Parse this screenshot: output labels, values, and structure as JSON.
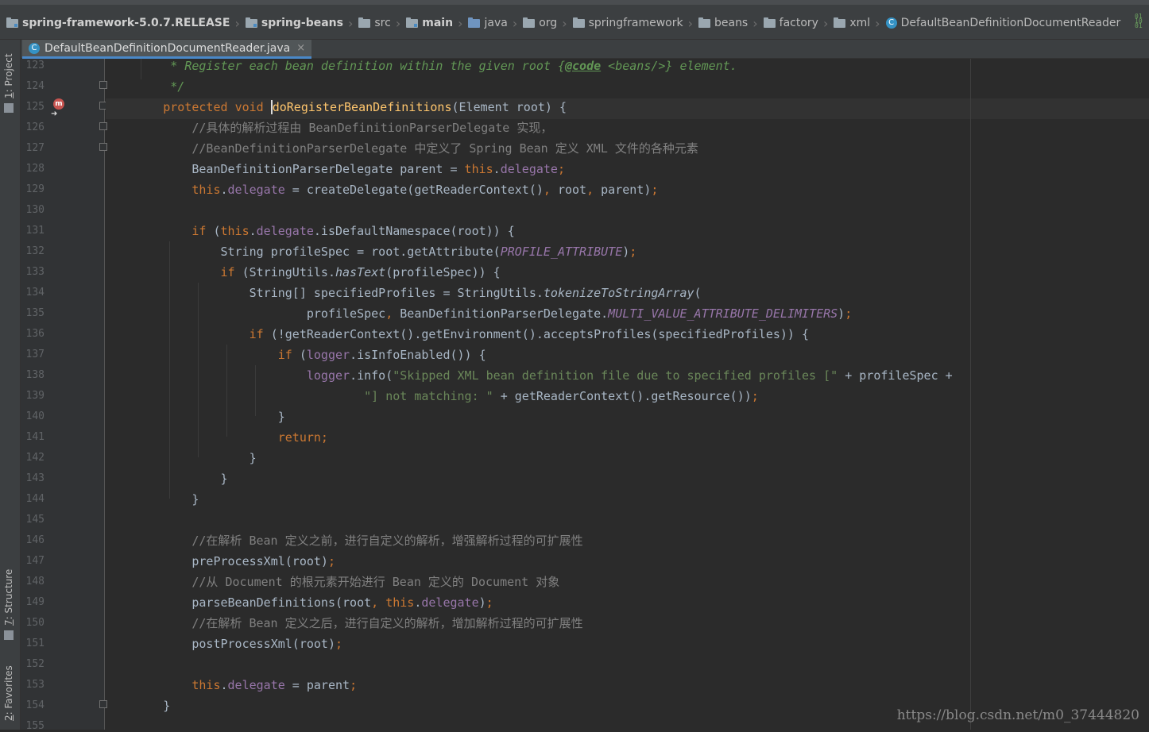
{
  "breadcrumbs": [
    {
      "label": "spring-framework-5.0.7.RELEASE",
      "icon": "module-folder-icon",
      "bold": true
    },
    {
      "label": "spring-beans",
      "icon": "module-folder-icon",
      "bold": true
    },
    {
      "label": "src",
      "icon": "folder-icon"
    },
    {
      "label": "main",
      "icon": "module-folder-icon",
      "bold": true
    },
    {
      "label": "java",
      "icon": "source-folder-icon"
    },
    {
      "label": "org",
      "icon": "package-icon"
    },
    {
      "label": "springframework",
      "icon": "package-icon"
    },
    {
      "label": "beans",
      "icon": "package-icon"
    },
    {
      "label": "factory",
      "icon": "package-icon"
    },
    {
      "label": "xml",
      "icon": "package-icon"
    },
    {
      "label": "DefaultBeanDefinitionDocumentReader",
      "icon": "class-icon"
    }
  ],
  "editor_tab": {
    "title": "DefaultBeanDefinitionDocumentReader.java",
    "close": "×",
    "icon_letter": "C"
  },
  "tool_windows": {
    "project": {
      "num": "1",
      "label": ": Project"
    },
    "structure": {
      "num": "7",
      "label": ": Structure"
    },
    "favorites": {
      "num": "2",
      "label": ": Favorites"
    }
  },
  "breakpoint_letter": "m",
  "line_numbers": [
    "123",
    "124",
    "125",
    "126",
    "127",
    "128",
    "129",
    "130",
    "131",
    "132",
    "133",
    "134",
    "135",
    "136",
    "137",
    "138",
    "139",
    "140",
    "141",
    "142",
    "143",
    "144",
    "145",
    "146",
    "147",
    "148",
    "149",
    "150",
    "151",
    "152",
    "153",
    "154",
    "155"
  ],
  "code_lines": [
    [
      {
        "t": "         ",
        "c": ""
      },
      {
        "t": "* Register each bean definition within the given root ",
        "c": "dcm"
      },
      {
        "t": "{",
        "c": "dcm"
      },
      {
        "t": "@code",
        "c": "dtag"
      },
      {
        "t": " <beans/>} element.",
        "c": "dcm"
      }
    ],
    [
      {
        "t": "         ",
        "c": ""
      },
      {
        "t": "*/",
        "c": "dcm"
      }
    ],
    [
      {
        "t": "        ",
        "c": ""
      },
      {
        "t": "protected",
        "c": "kw"
      },
      {
        "t": " ",
        "c": ""
      },
      {
        "t": "void",
        "c": "kw"
      },
      {
        "t": " ",
        "c": ""
      },
      {
        "t": "doRegisterBeanDefinitions",
        "c": "fn caret"
      },
      {
        "t": "(Element root) {",
        "c": ""
      }
    ],
    [
      {
        "t": "            ",
        "c": ""
      },
      {
        "t": "//具体的解析过程由 BeanDefinitionParserDelegate 实现，",
        "c": "cmt"
      }
    ],
    [
      {
        "t": "            ",
        "c": ""
      },
      {
        "t": "//BeanDefinitionParserDelegate 中定义了 Spring Bean 定义 XML 文件的各种元素",
        "c": "cmt"
      }
    ],
    [
      {
        "t": "            BeanDefinitionParserDelegate parent = ",
        "c": ""
      },
      {
        "t": "this",
        "c": "kw"
      },
      {
        "t": ".",
        "c": ""
      },
      {
        "t": "delegate",
        "c": "fld"
      },
      {
        "t": ";",
        "c": "kw"
      }
    ],
    [
      {
        "t": "            ",
        "c": ""
      },
      {
        "t": "this",
        "c": "kw"
      },
      {
        "t": ".",
        "c": ""
      },
      {
        "t": "delegate",
        "c": "fld"
      },
      {
        "t": " = createDelegate(getReaderContext()",
        "c": ""
      },
      {
        "t": ",",
        "c": "kw"
      },
      {
        "t": " root",
        "c": ""
      },
      {
        "t": ",",
        "c": "kw"
      },
      {
        "t": " parent)",
        "c": ""
      },
      {
        "t": ";",
        "c": "kw"
      }
    ],
    [
      {
        "t": "",
        "c": ""
      }
    ],
    [
      {
        "t": "            ",
        "c": ""
      },
      {
        "t": "if",
        "c": "kw"
      },
      {
        "t": " (",
        "c": ""
      },
      {
        "t": "this",
        "c": "kw"
      },
      {
        "t": ".",
        "c": ""
      },
      {
        "t": "delegate",
        "c": "fld"
      },
      {
        "t": ".isDefaultNamespace(root)) {",
        "c": ""
      }
    ],
    [
      {
        "t": "                String profileSpec = root.getAttribute(",
        "c": ""
      },
      {
        "t": "PROFILE_ATTRIBUTE",
        "c": "cst"
      },
      {
        "t": ")",
        "c": ""
      },
      {
        "t": ";",
        "c": "kw"
      }
    ],
    [
      {
        "t": "                ",
        "c": ""
      },
      {
        "t": "if",
        "c": "kw"
      },
      {
        "t": " (StringUtils.",
        "c": ""
      },
      {
        "t": "hasText",
        "c": "sta"
      },
      {
        "t": "(profileSpec)) {",
        "c": ""
      }
    ],
    [
      {
        "t": "                    String[] specifiedProfiles = StringUtils.",
        "c": ""
      },
      {
        "t": "tokenizeToStringArray",
        "c": "sta"
      },
      {
        "t": "(",
        "c": ""
      }
    ],
    [
      {
        "t": "                            profileSpec",
        "c": ""
      },
      {
        "t": ",",
        "c": "kw"
      },
      {
        "t": " BeanDefinitionParserDelegate.",
        "c": ""
      },
      {
        "t": "MULTI_VALUE_ATTRIBUTE_DELIMITERS",
        "c": "cst"
      },
      {
        "t": ")",
        "c": ""
      },
      {
        "t": ";",
        "c": "kw"
      }
    ],
    [
      {
        "t": "                    ",
        "c": ""
      },
      {
        "t": "if",
        "c": "kw"
      },
      {
        "t": " (!getReaderContext().getEnvironment().acceptsProfiles(specifiedProfiles)) {",
        "c": ""
      }
    ],
    [
      {
        "t": "                        ",
        "c": ""
      },
      {
        "t": "if",
        "c": "kw"
      },
      {
        "t": " (",
        "c": ""
      },
      {
        "t": "logger",
        "c": "fld"
      },
      {
        "t": ".isInfoEnabled()) {",
        "c": ""
      }
    ],
    [
      {
        "t": "                            ",
        "c": ""
      },
      {
        "t": "logger",
        "c": "fld"
      },
      {
        "t": ".info(",
        "c": ""
      },
      {
        "t": "\"Skipped XML bean definition file due to specified profiles [\"",
        "c": "str"
      },
      {
        "t": " + profileSpec +",
        "c": ""
      }
    ],
    [
      {
        "t": "                                    ",
        "c": ""
      },
      {
        "t": "\"] not matching: \"",
        "c": "str"
      },
      {
        "t": " + getReaderContext().getResource())",
        "c": ""
      },
      {
        "t": ";",
        "c": "kw"
      }
    ],
    [
      {
        "t": "                        }",
        "c": ""
      }
    ],
    [
      {
        "t": "                        ",
        "c": ""
      },
      {
        "t": "return;",
        "c": "kw"
      }
    ],
    [
      {
        "t": "                    }",
        "c": ""
      }
    ],
    [
      {
        "t": "                }",
        "c": ""
      }
    ],
    [
      {
        "t": "            }",
        "c": ""
      }
    ],
    [
      {
        "t": "",
        "c": ""
      }
    ],
    [
      {
        "t": "            ",
        "c": ""
      },
      {
        "t": "//在解析 Bean 定义之前，进行自定义的解析，增强解析过程的可扩展性",
        "c": "cmt"
      }
    ],
    [
      {
        "t": "            preProcessXml(root)",
        "c": ""
      },
      {
        "t": ";",
        "c": "kw"
      }
    ],
    [
      {
        "t": "            ",
        "c": ""
      },
      {
        "t": "//从 Document 的根元素开始进行 Bean 定义的 Document 对象",
        "c": "cmt"
      }
    ],
    [
      {
        "t": "            parseBeanDefinitions(root",
        "c": ""
      },
      {
        "t": ",",
        "c": "kw"
      },
      {
        "t": " ",
        "c": ""
      },
      {
        "t": "this",
        "c": "kw"
      },
      {
        "t": ".",
        "c": ""
      },
      {
        "t": "delegate",
        "c": "fld"
      },
      {
        "t": ")",
        "c": ""
      },
      {
        "t": ";",
        "c": "kw"
      }
    ],
    [
      {
        "t": "            ",
        "c": ""
      },
      {
        "t": "//在解析 Bean 定义之后，进行自定义的解析，增加解析过程的可扩展性",
        "c": "cmt"
      }
    ],
    [
      {
        "t": "            postProcessXml(root)",
        "c": ""
      },
      {
        "t": ";",
        "c": "kw"
      }
    ],
    [
      {
        "t": "",
        "c": ""
      }
    ],
    [
      {
        "t": "            ",
        "c": ""
      },
      {
        "t": "this",
        "c": "kw"
      },
      {
        "t": ".",
        "c": ""
      },
      {
        "t": "delegate",
        "c": "fld"
      },
      {
        "t": " = parent",
        "c": ""
      },
      {
        "t": ";",
        "c": "kw"
      }
    ],
    [
      {
        "t": "        }",
        "c": ""
      }
    ],
    [
      {
        "t": "",
        "c": ""
      }
    ]
  ],
  "current_line_index": 2,
  "watermark": "https://blog.csdn.net/m0_37444820",
  "colors": {
    "background": "#2b2b2b",
    "keyword": "#cc7832",
    "field": "#9876aa",
    "method": "#ffc66d",
    "string": "#6a8759",
    "comment": "#808080",
    "doc_comment": "#629755"
  }
}
